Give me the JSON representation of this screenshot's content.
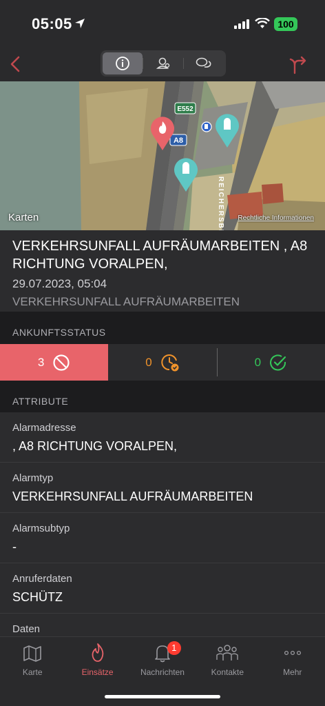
{
  "status": {
    "time": "05:05",
    "battery": "100"
  },
  "map": {
    "logo": "Karten",
    "legal": "Rechtliche Informationen",
    "road_labels": [
      "E552",
      "A8"
    ],
    "street_label": "REICHERSBE"
  },
  "incident": {
    "title": "VERKEHRSUNFALL AUFRÄUMARBEITEN , A8 RICHTUNG VORALPEN,",
    "datetime": "29.07.2023, 05:04",
    "type": "VERKEHRSUNFALL AUFRÄUMARBEITEN"
  },
  "arrival": {
    "header": "ANKUNFTSSTATUS",
    "declined": "3",
    "pending": "0",
    "confirmed": "0"
  },
  "attributes": {
    "header": "ATTRIBUTE",
    "items": [
      {
        "label": "Alarmadresse",
        "value": ", A8 RICHTUNG VORALPEN,"
      },
      {
        "label": "Alarmtyp",
        "value": "VERKEHRSUNFALL AUFRÄUMARBEITEN"
      },
      {
        "label": "Alarmsubtyp",
        "value": "-"
      },
      {
        "label": "Anruferdaten",
        "value": "SCHÜTZ"
      },
      {
        "label": "Daten",
        "value": ""
      }
    ]
  },
  "tabs": [
    {
      "label": "Karte"
    },
    {
      "label": "Einsätze"
    },
    {
      "label": "Nachrichten",
      "badge": "1"
    },
    {
      "label": "Kontakte"
    },
    {
      "label": "Mehr"
    }
  ],
  "colors": {
    "accent": "#e8646a",
    "pending": "#f0932b",
    "confirmed": "#34c759"
  }
}
